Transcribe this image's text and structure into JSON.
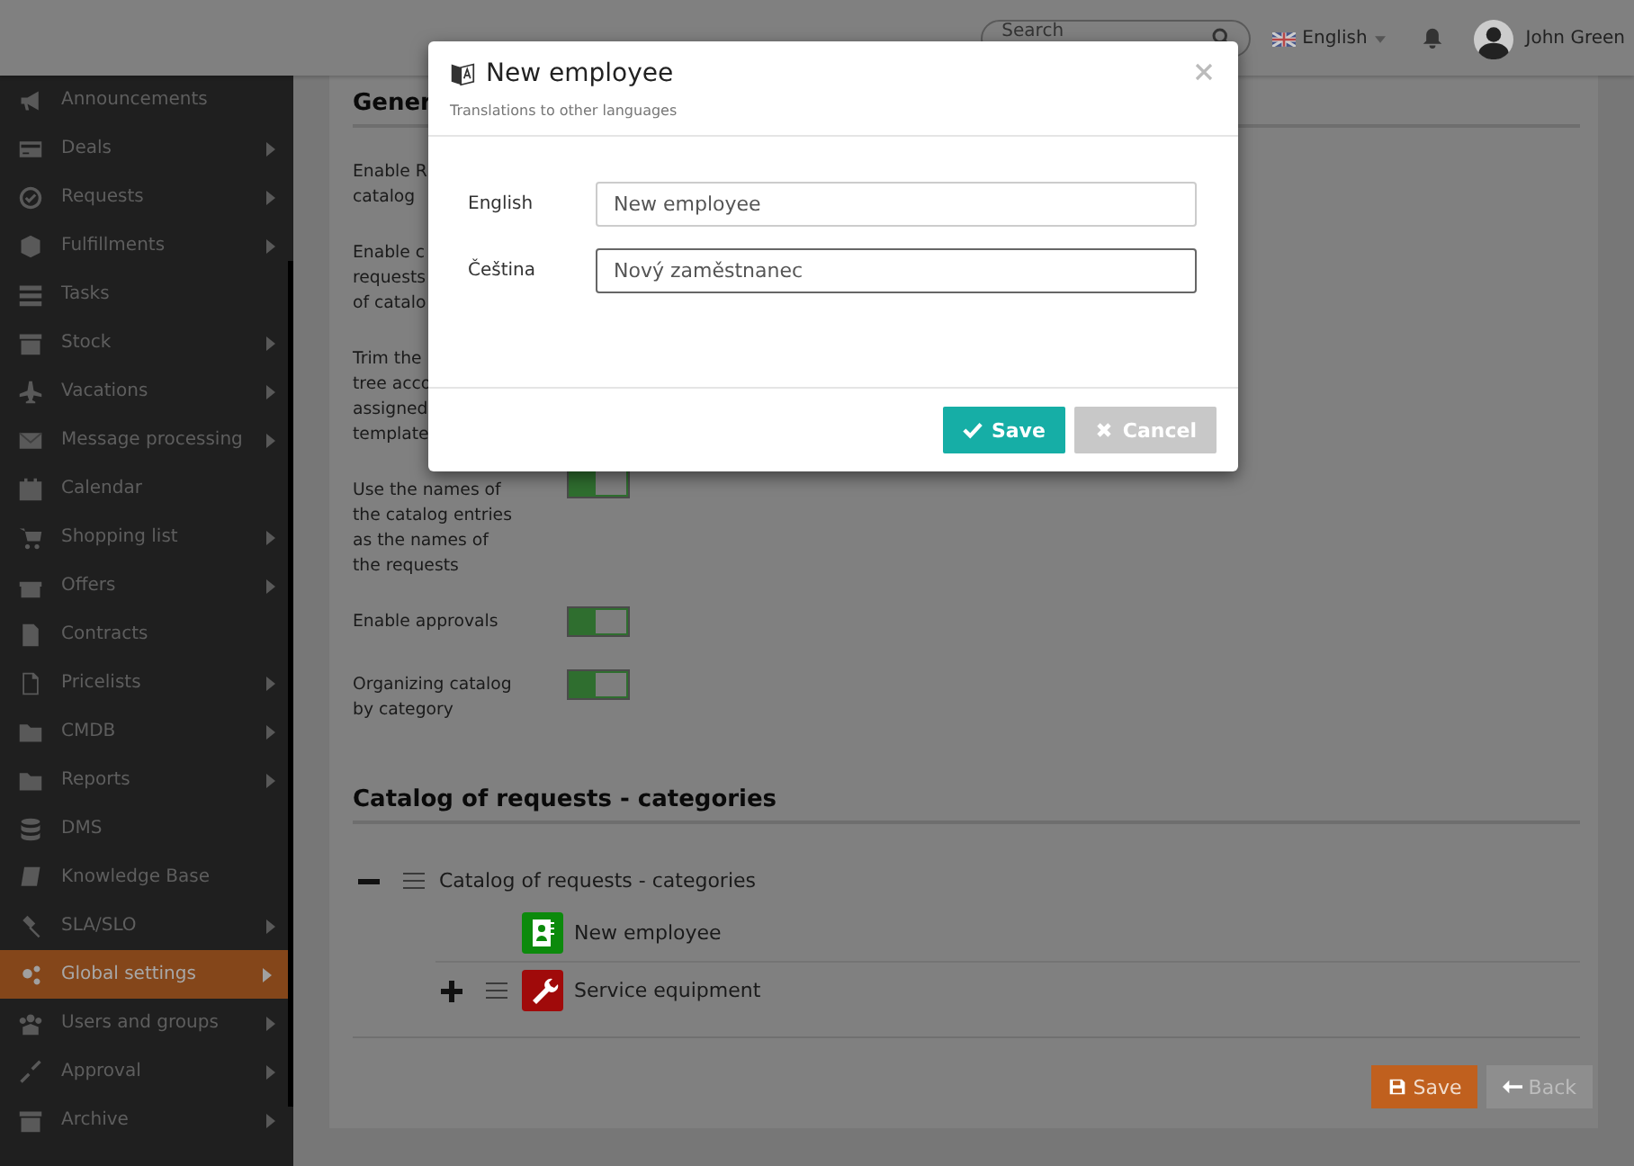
{
  "topbar": {
    "search": {
      "placeholder": "Search"
    },
    "language": "English",
    "user": "John Green"
  },
  "sidebar": {
    "items": [
      {
        "label": "Announcements",
        "submenu": false,
        "selected": false
      },
      {
        "label": "Deals",
        "submenu": true,
        "selected": false
      },
      {
        "label": "Requests",
        "submenu": true,
        "selected": false
      },
      {
        "label": "Fulfillments",
        "submenu": true,
        "selected": false
      },
      {
        "label": "Tasks",
        "submenu": false,
        "selected": false
      },
      {
        "label": "Stock",
        "submenu": true,
        "selected": false
      },
      {
        "label": "Vacations",
        "submenu": true,
        "selected": false
      },
      {
        "label": "Message processing",
        "submenu": true,
        "selected": false
      },
      {
        "label": "Calendar",
        "submenu": false,
        "selected": false
      },
      {
        "label": "Shopping list",
        "submenu": true,
        "selected": false
      },
      {
        "label": "Offers",
        "submenu": true,
        "selected": false
      },
      {
        "label": "Contracts",
        "submenu": false,
        "selected": false
      },
      {
        "label": "Pricelists",
        "submenu": true,
        "selected": false
      },
      {
        "label": "CMDB",
        "submenu": true,
        "selected": false
      },
      {
        "label": "Reports",
        "submenu": true,
        "selected": false
      },
      {
        "label": "DMS",
        "submenu": false,
        "selected": false
      },
      {
        "label": "Knowledge Base",
        "submenu": false,
        "selected": false
      },
      {
        "label": "SLA/SLO",
        "submenu": true,
        "selected": false
      },
      {
        "label": "Global settings",
        "submenu": true,
        "selected": true
      },
      {
        "label": "Users and groups",
        "submenu": true,
        "selected": false
      },
      {
        "label": "Approval",
        "submenu": true,
        "selected": false
      },
      {
        "label": "Archive",
        "submenu": true,
        "selected": false
      }
    ]
  },
  "general": {
    "heading": "Gener",
    "settings": [
      {
        "label": "Enable R\ncatalog"
      },
      {
        "label": "Enable c\nrequests\nof catalo"
      },
      {
        "label": "Trim the\ntree acco\nassigned\ntemplate"
      },
      {
        "label": "Use the names of\nthe catalog entries\nas the names of\nthe requests",
        "on": true
      },
      {
        "label": "Enable approvals",
        "on": true
      },
      {
        "label": "Organizing catalog\nby category",
        "on": true
      }
    ]
  },
  "catalog": {
    "heading": "Catalog of requests - categories",
    "tree": [
      {
        "label": "Catalog of requests - categories",
        "expanded": true,
        "children": [
          {
            "label": "New employee",
            "kind": "contact",
            "color": "#0c8a0c"
          },
          {
            "label": "Service equipment",
            "kind": "tool",
            "color": "#a00a0a",
            "expanded": false
          }
        ]
      }
    ]
  },
  "actions": [
    {
      "label": "Save",
      "kind": "primary"
    },
    {
      "label": "Back",
      "kind": "back"
    }
  ],
  "dialog": {
    "title": "New employee",
    "subtitle": "Translations to other languages",
    "fields": [
      {
        "label": "English",
        "value": "New employee",
        "focused": false
      },
      {
        "label": "Čeština",
        "value": "Nový zaměstnanec",
        "focused": true
      }
    ],
    "buttons": [
      {
        "label": "Save",
        "kind": "primary"
      },
      {
        "label": "Cancel",
        "kind": "secondary"
      }
    ]
  }
}
